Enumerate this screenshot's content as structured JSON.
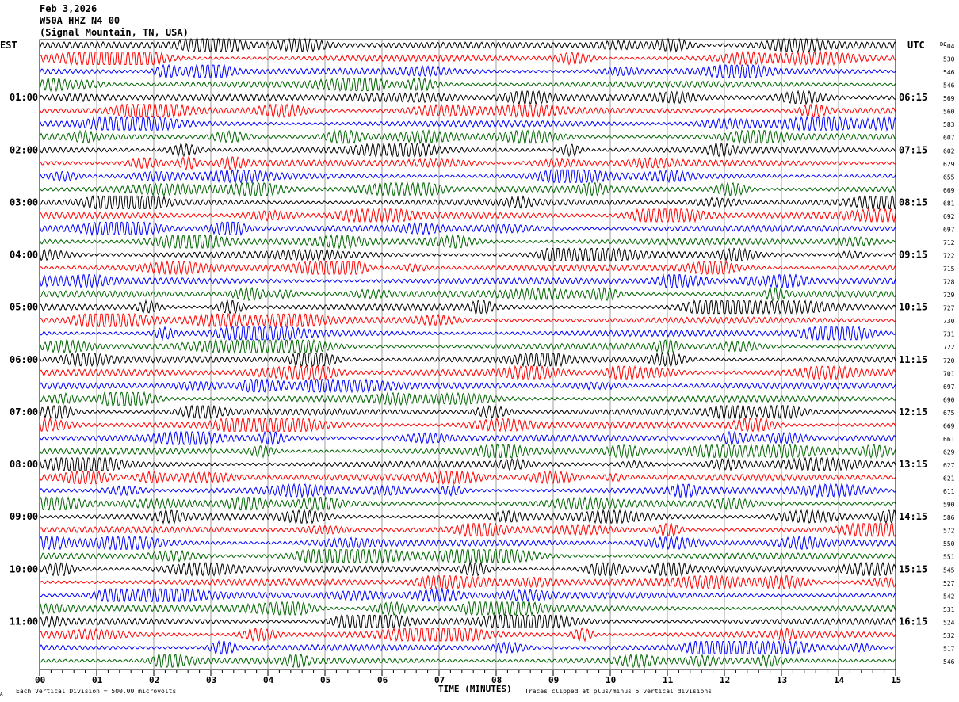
{
  "header": {
    "date": "Feb 3,2026",
    "station": "W50A HHZ N4 00",
    "location": "(Signal Mountain, TN, USA)"
  },
  "left_axis_title": "EST",
  "right_axis_title": "UTC",
  "dc_title": "DC",
  "footer": {
    "scale_note": "Each Vertical Division =  500.00 microvolts",
    "xlabel": "TIME (MINUTES)",
    "clip_note": "Traces clipped at plus/minus 5 vertical divisions",
    "corner_mark": "A"
  },
  "chart_data": {
    "type": "line",
    "subtype": "helicorder",
    "xlabel": "TIME (MINUTES)",
    "xlim": [
      0,
      15
    ],
    "x_ticks": [
      "00",
      "01",
      "02",
      "03",
      "04",
      "05",
      "06",
      "07",
      "08",
      "09",
      "10",
      "11",
      "12",
      "13",
      "14",
      "15"
    ],
    "grid": "vertical lines each minute",
    "trace_count": 48,
    "minutes_per_trace": 15,
    "trace_colors": [
      "#000000",
      "#ff0000",
      "#0000ff",
      "#006400"
    ],
    "left_time_labels": [
      "01:00",
      "02:00",
      "03:00",
      "04:00",
      "05:00",
      "06:00",
      "07:00",
      "08:00",
      "09:00",
      "10:00",
      "11:00"
    ],
    "right_time_labels": [
      "06:15",
      "07:15",
      "08:15",
      "09:15",
      "10:15",
      "11:15",
      "12:15",
      "13:15",
      "14:15",
      "15:15",
      "16:15"
    ],
    "dc_offsets": [
      504,
      530,
      546,
      546,
      569,
      560,
      583,
      607,
      602,
      629,
      655,
      669,
      681,
      692,
      697,
      712,
      722,
      715,
      728,
      729,
      727,
      730,
      731,
      722,
      720,
      701,
      697,
      690,
      675,
      669,
      661,
      629,
      627,
      621,
      611,
      590,
      586,
      572,
      550,
      551,
      545,
      527,
      542,
      531,
      524,
      532,
      517,
      546
    ]
  }
}
